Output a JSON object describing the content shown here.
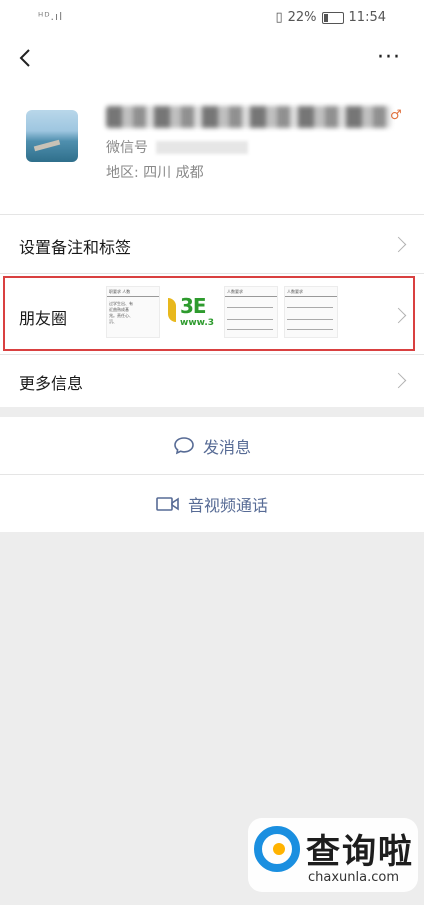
{
  "status_bar": {
    "signal_text": "ᴴᴰ.ıl",
    "battery_percent": "22%",
    "time": "11:54"
  },
  "navbar": {
    "back_icon": "chevron-left-icon",
    "more_icon": "more-horizontal-icon"
  },
  "profile": {
    "wechat_id_label": "微信号",
    "region": "地区: 四川 成都"
  },
  "rows": {
    "remarks_label": "设置备注和标签",
    "moments_label": "朋友圈",
    "more_info_label": "更多信息"
  },
  "moments_thumbs": {
    "thumb1_header": "职要求      人数",
    "thumb1_lines": [
      "过学生出、有",
      "近曲熟成基",
      "兆。责任心、",
      "沉、"
    ],
    "logo_text": "3E",
    "logo_url": "www.3",
    "thumb3_header": "人数要求",
    "thumb4_header": "人数要求"
  },
  "actions": {
    "message_label": "发消息",
    "call_label": "音视频通话"
  },
  "watermark": {
    "brand": "查询啦",
    "url": "chaxunla.com"
  },
  "colors": {
    "link": "#576b95",
    "highlight": "#d94040",
    "background": "#ededed"
  }
}
